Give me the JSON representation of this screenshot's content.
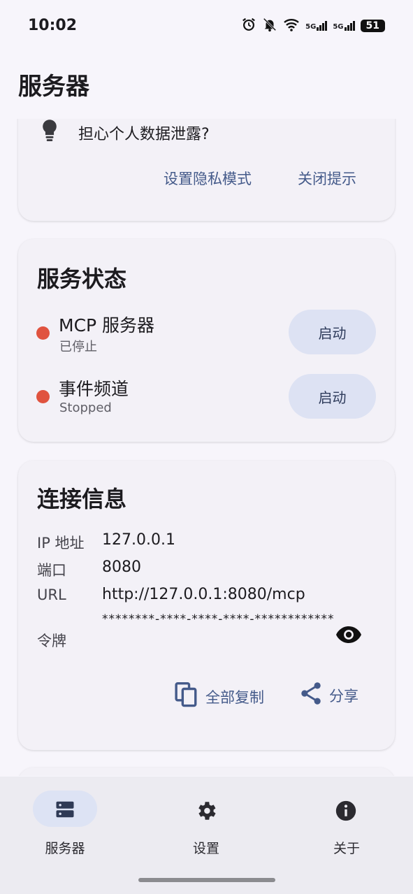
{
  "status_bar": {
    "time": "10:02",
    "icons": [
      "alarm-icon",
      "bell-off-icon",
      "wifi-icon",
      "signal-5g-icon",
      "signal-5g-icon"
    ],
    "network_1": "5G",
    "network_2": "5G",
    "battery": "51"
  },
  "header": {
    "title": "服务器"
  },
  "privacy_tip": {
    "icon": "lightbulb-icon",
    "text": "担心个人数据泄露?",
    "set_privacy_label": "设置隐私模式",
    "dismiss_label": "关闭提示"
  },
  "service_status": {
    "title": "服务状态",
    "status_color": "#e0533f",
    "items": [
      {
        "name": "MCP 服务器",
        "status": "已停止",
        "button": "启动"
      },
      {
        "name": "事件频道",
        "status": "Stopped",
        "button": "启动"
      }
    ]
  },
  "connection": {
    "title": "连接信息",
    "ip_label": "IP 地址",
    "ip_value": "127.0.0.1",
    "port_label": "端口",
    "port_value": "8080",
    "url_label": "URL",
    "url_value": "http://127.0.0.1:8080/mcp",
    "token_label": "令牌",
    "token_value": "********-****-****-****-************",
    "copy_all_label": "全部复制",
    "share_label": "分享"
  },
  "bottom_nav": [
    {
      "label": "服务器",
      "icon": "server-icon",
      "selected": true
    },
    {
      "label": "设置",
      "icon": "gear-icon",
      "selected": false
    },
    {
      "label": "关于",
      "icon": "info-icon",
      "selected": false
    }
  ],
  "colors": {
    "accent": "#445a8a",
    "background": "#f7f5fb",
    "card": "#f3f1f7",
    "stopped_dot": "#e0533f",
    "button_tonal": "#dde2f3"
  }
}
